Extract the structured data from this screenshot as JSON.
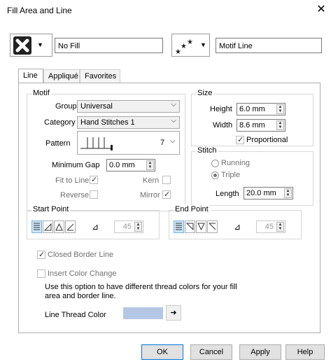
{
  "window": {
    "title": "Fill Area and Line",
    "close": "✕"
  },
  "fill": {
    "value": "No Fill"
  },
  "line": {
    "value": "Motif Line"
  },
  "tabs": [
    "Line",
    "Appliqué",
    "Favorites"
  ],
  "motif": {
    "label": "Motif",
    "group_label": "Group",
    "group_value": "Universal",
    "category_label": "Category",
    "category_value": "Hand Stitches 1",
    "pattern_label": "Pattern",
    "pattern_number": "7",
    "min_gap_label": "Minimum Gap",
    "min_gap_value": "0.0 mm",
    "fit_to_line": "Fit to Line",
    "kern": "Kern",
    "reverse": "Reverse",
    "mirror": "Mirror"
  },
  "size": {
    "label": "Size",
    "height_label": "Height",
    "height_value": "6.0 mm",
    "width_label": "Width",
    "width_value": "8.6 mm",
    "proportional": "Proportional"
  },
  "stitch": {
    "label": "Stitch",
    "running": "Running",
    "triple": "Triple",
    "length_label": "Length",
    "length_value": "20.0 mm"
  },
  "start_point": {
    "label": "Start Point",
    "angle": "45"
  },
  "end_point": {
    "label": "End Point",
    "angle": "45"
  },
  "closed_border": "Closed Border Line",
  "insert_color": "Insert Color Change",
  "info": "Use this option to have different thread colors for your fill area and border line.",
  "thread_color_label": "Line Thread Color",
  "colors": {
    "thread": "#b4c8e6",
    "accent": "#0078d7"
  },
  "buttons": {
    "ok": "OK",
    "cancel": "Cancel",
    "apply": "Apply",
    "help": "Help"
  }
}
